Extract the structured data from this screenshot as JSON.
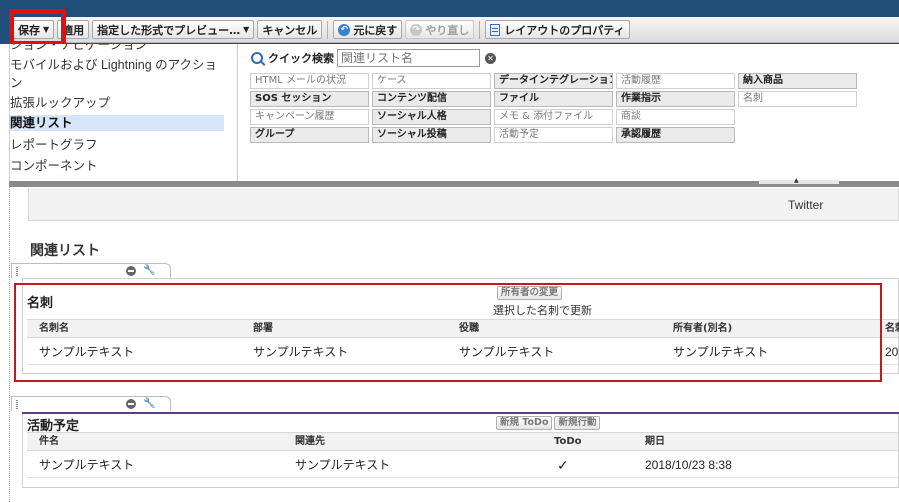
{
  "toolbar": {
    "save": "保存",
    "apply": "適用",
    "preview": "指定した形式でプレビュー…",
    "cancel": "キャンセル",
    "undo": "元に戻す",
    "redo": "やり直し",
    "layout_props": "レイアウトのプロパティ"
  },
  "palette": {
    "categories": [
      "ション・ナビゲーション",
      "モバイルおよび Lightning のアクショ",
      "ン",
      "拡張ルックアップ",
      "関連リスト",
      "レポートグラフ",
      "コンポーネント"
    ],
    "selected_index": 4,
    "quick_search_label": "クイック検索",
    "quick_search_placeholder": "関連リスト名",
    "items": [
      {
        "label": "HTML メールの状況",
        "used": false
      },
      {
        "label": "ケース",
        "used": false
      },
      {
        "label": "データインテグレーション",
        "used": true
      },
      {
        "label": "活動履歴",
        "used": false
      },
      {
        "label": "納入商品",
        "used": true
      },
      {
        "label": "SOS セッション",
        "used": true
      },
      {
        "label": "コンテンツ配信",
        "used": true
      },
      {
        "label": "ファイル",
        "used": true
      },
      {
        "label": "作業指示",
        "used": true
      },
      {
        "label": "名刺",
        "used": false
      },
      {
        "label": "キャンペーン履歴",
        "used": false
      },
      {
        "label": "ソーシャル人格",
        "used": true
      },
      {
        "label": "メモ & 添付ファイル",
        "used": false
      },
      {
        "label": "商談",
        "used": false
      },
      {
        "label": "",
        "used": false
      },
      {
        "label": "グループ",
        "used": true
      },
      {
        "label": "ソーシャル投稿",
        "used": true
      },
      {
        "label": "活動予定",
        "used": false
      },
      {
        "label": "承認履歴",
        "used": true
      },
      {
        "label": "",
        "used": false
      }
    ]
  },
  "page": {
    "twitter": "Twitter",
    "section_title": "関連リスト"
  },
  "meishi": {
    "title": "名刺",
    "button": "所有者の変更",
    "sub": "選択した名刺で更新",
    "columns": [
      "名刺名",
      "部署",
      "役職",
      "所有者(別名)",
      "名刺"
    ],
    "row": [
      "サンプルテキスト",
      "サンプルテキスト",
      "サンプルテキスト",
      "サンプルテキスト",
      "20"
    ]
  },
  "activity": {
    "title": "活動予定",
    "buttons": [
      "新規 ToDo",
      "新規行動"
    ],
    "columns": [
      "件名",
      "関連先",
      "ToDo",
      "期日"
    ],
    "row": [
      "サンプルテキスト",
      "サンプルテキスト",
      "✓",
      "2018/10/23 8:38"
    ]
  },
  "colors": {
    "header_band": "#1f4f79",
    "highlight_red": "#e01010",
    "selected_bg": "#d4e6f7"
  }
}
